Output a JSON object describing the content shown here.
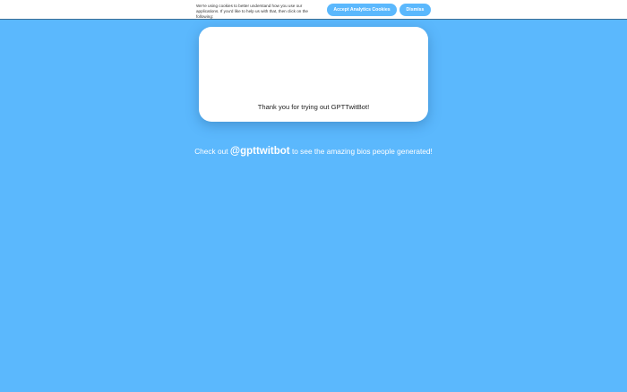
{
  "cookie_banner": {
    "message": "We're using cookies to better understand how you use our applications. If you'd like to help us with that, then click on the following:",
    "accept_label": "Accept Analytics Cookies",
    "dismiss_label": "Dismiss"
  },
  "card": {
    "message": "Thank you for trying out GPTTwitBot!"
  },
  "promo": {
    "prefix": "Check out",
    "handle": "@gpttwitbot",
    "suffix": "to see the amazing bios people generated!"
  },
  "colors": {
    "background": "#5bb8fd",
    "accent": "#5bb8fd",
    "card": "#ffffff"
  }
}
